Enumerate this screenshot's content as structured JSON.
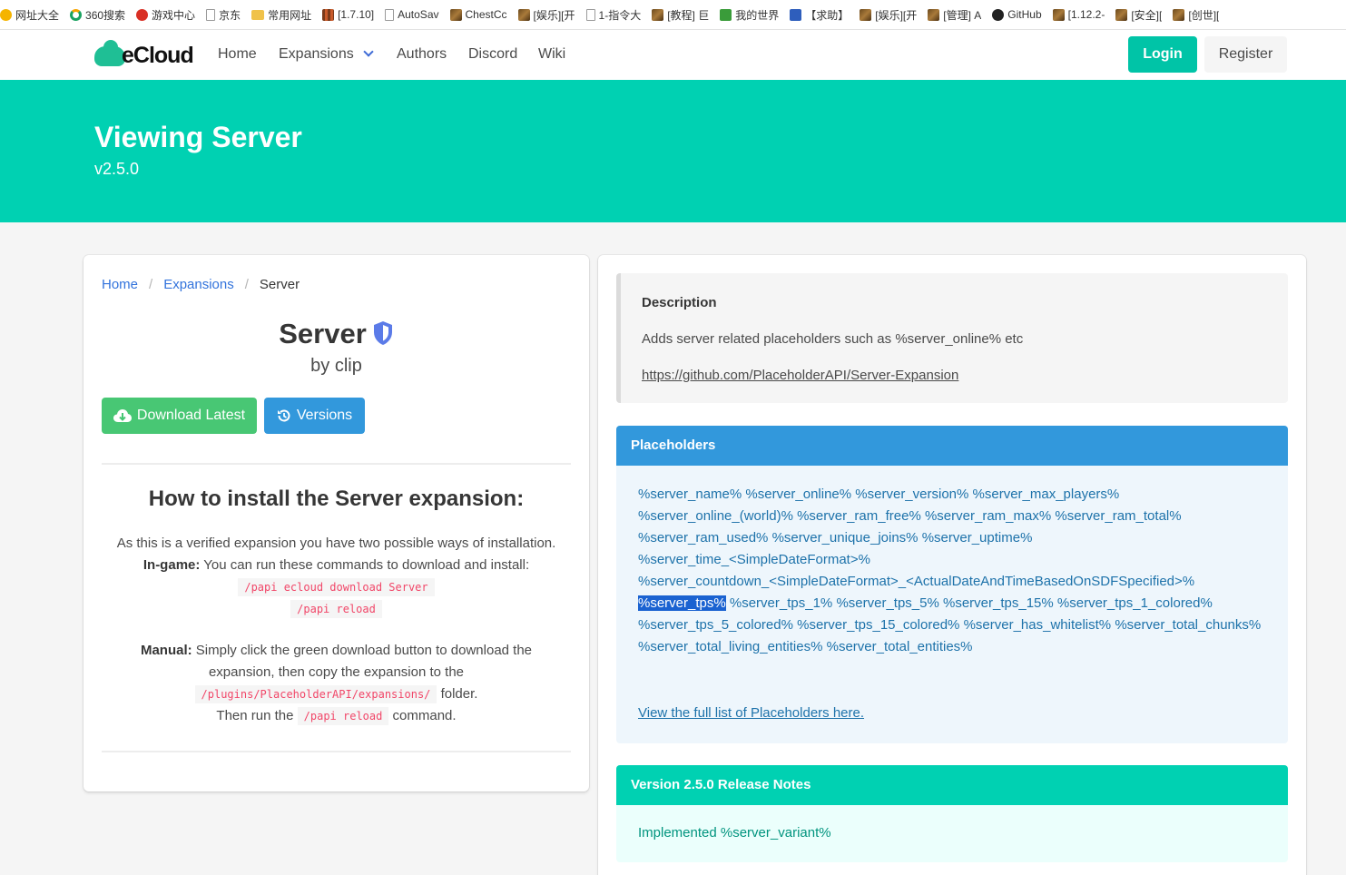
{
  "bookmarks": [
    {
      "label": "网址大全",
      "icon": "plus"
    },
    {
      "label": "360搜索",
      "icon": "ring"
    },
    {
      "label": "游戏中心",
      "icon": "red"
    },
    {
      "label": "京东",
      "icon": "doc"
    },
    {
      "label": "常用网址",
      "icon": "folder"
    },
    {
      "label": "[1.7.10]",
      "icon": "pix"
    },
    {
      "label": "AutoSav",
      "icon": "doc"
    },
    {
      "label": "ChestCc",
      "icon": "cube"
    },
    {
      "label": "[娱乐][开",
      "icon": "cube"
    },
    {
      "label": "1-指令大",
      "icon": "doc"
    },
    {
      "label": "[教程] 巨",
      "icon": "cube"
    },
    {
      "label": "我的世界",
      "icon": "green"
    },
    {
      "label": "【求助】",
      "icon": "paw"
    },
    {
      "label": "[娱乐][开",
      "icon": "cube"
    },
    {
      "label": "[管理] A",
      "icon": "cube"
    },
    {
      "label": "GitHub",
      "icon": "gh"
    },
    {
      "label": "[1.12.2-",
      "icon": "cube"
    },
    {
      "label": "[安全][",
      "icon": "cube"
    },
    {
      "label": "[创世][",
      "icon": "cube"
    }
  ],
  "nav": {
    "logo": "eCloud",
    "home": "Home",
    "expansions": "Expansions",
    "authors": "Authors",
    "discord": "Discord",
    "wiki": "Wiki",
    "login": "Login",
    "register": "Register"
  },
  "hero": {
    "title": "Viewing Server",
    "version": "v2.5.0"
  },
  "breadcrumb": {
    "home": "Home",
    "expansions": "Expansions",
    "current": "Server",
    "sep": "/"
  },
  "expansion": {
    "name": "Server",
    "author": "by clip",
    "download_label": "Download Latest",
    "versions_label": "Versions"
  },
  "install": {
    "title": "How to install the Server expansion:",
    "intro": "As this is a verified expansion you have two possible ways of installation.",
    "ingame_label": "In-game:",
    "ingame_text": "You can run these commands to download and install:",
    "cmd_download": "/papi ecloud download Server",
    "cmd_reload": "/papi reload",
    "manual_label": "Manual:",
    "manual_text": "Simply click the green download button to download the expansion, then copy the expansion to the",
    "manual_path": "/plugins/PlaceholderAPI/expansions/",
    "manual_folder": "folder.",
    "then_run": "Then run the",
    "then_cmd": "/papi reload",
    "then_end": "command."
  },
  "description": {
    "heading": "Description",
    "text": "Adds server related placeholders such as %server_online% etc",
    "link": "https://github.com/PlaceholderAPI/Server-Expansion"
  },
  "placeholders": {
    "heading": "Placeholders",
    "items": [
      "%server_name%",
      "%server_online%",
      "%server_version%",
      "%server_max_players%",
      "%server_online_(world)%",
      "%server_ram_free%",
      "%server_ram_max%",
      "%server_ram_total%",
      "%server_ram_used%",
      "%server_unique_joins%",
      "%server_uptime%",
      "%server_time_<SimpleDateFormat>%",
      "%server_countdown_<SimpleDateFormat>_<ActualDateAndTimeBasedOnSDFSpecified>%",
      "%server_tps%",
      "%server_tps_1%",
      "%server_tps_5%",
      "%server_tps_15%",
      "%server_tps_1_colored%",
      "%server_tps_5_colored%",
      "%server_tps_15_colored%",
      "%server_has_whitelist%",
      "%server_total_chunks%",
      "%server_total_living_entities%",
      "%server_total_entities%"
    ],
    "selected_index": 13,
    "full_list_link": "View the full list of Placeholders here."
  },
  "release_notes": {
    "heading": "Version 2.5.0 Release Notes",
    "text": "Implemented %server_variant%"
  },
  "colors": {
    "primary": "#00d1b2",
    "login": "#00c4a7",
    "success": "#48c774",
    "info": "#3298dc",
    "link": "#3273dc",
    "shield": "#5b7be8",
    "code": "#f14668"
  }
}
